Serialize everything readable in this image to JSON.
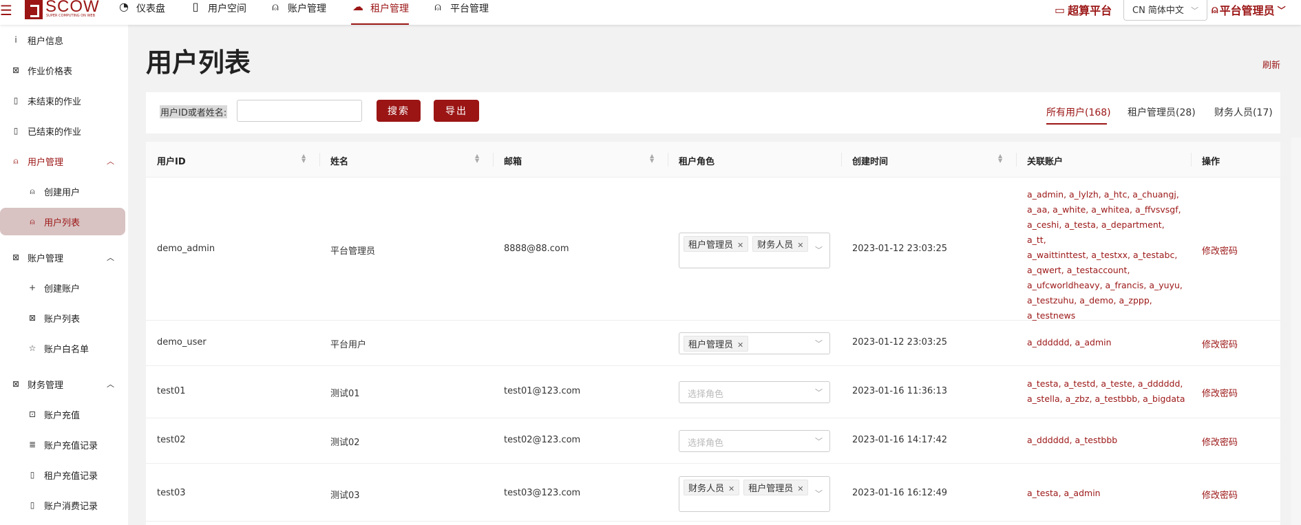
{
  "topbar": {
    "menu_icon": "hamburger-icon",
    "logo_name": "SCOW",
    "logo_sub": "SUPER COMPUTING ON WEB",
    "nav": [
      {
        "label": "仪表盘",
        "icon": "dashboard-icon"
      },
      {
        "label": "用户空间",
        "icon": "document-icon"
      },
      {
        "label": "账户管理",
        "icon": "user-icon"
      },
      {
        "label": "租户管理",
        "icon": "cloud-icon"
      },
      {
        "label": "平台管理",
        "icon": "user-icon"
      }
    ],
    "active_nav": "租户管理",
    "brand": "超算平台",
    "lang": "CN 简体中文",
    "user": "平台管理员"
  },
  "sidebar": {
    "items": [
      {
        "label": "租户信息",
        "icon": "info-icon"
      },
      {
        "label": "作业价格表",
        "icon": "price-icon"
      },
      {
        "label": "未结束的作业",
        "icon": "document-icon"
      },
      {
        "label": "已结束的作业",
        "icon": "document-icon"
      },
      {
        "label": "用户管理",
        "icon": "user-icon"
      },
      {
        "label": "创建用户",
        "icon": "user-icon"
      },
      {
        "label": "用户列表",
        "icon": "user-icon"
      },
      {
        "label": "账户管理",
        "icon": "account-icon"
      },
      {
        "label": "创建账户",
        "icon": "plus-icon"
      },
      {
        "label": "账户列表",
        "icon": "account-icon"
      },
      {
        "label": "账户白名单",
        "icon": "star-icon"
      },
      {
        "label": "财务管理",
        "icon": "money-icon"
      },
      {
        "label": "账户充值",
        "icon": "money-icon"
      },
      {
        "label": "账户充值记录",
        "icon": "list-icon"
      },
      {
        "label": "租户充值记录",
        "icon": "document-icon"
      },
      {
        "label": "账户消费记录",
        "icon": "document-icon"
      }
    ]
  },
  "page": {
    "title": "用户列表",
    "refresh": "刷新"
  },
  "filter": {
    "label": "用户ID或者姓名:",
    "input_value": "",
    "search_button": "搜索",
    "export_button": "导出",
    "tabs": [
      "所有用户(168)",
      "租户管理员(28)",
      "财务人员(17)"
    ],
    "active_tab": "所有用户(168)"
  },
  "table": {
    "headers": [
      "用户ID",
      "姓名",
      "邮箱",
      "租户角色",
      "创建时间",
      "关联账户",
      "操作"
    ],
    "role_placeholder": "选择角色",
    "rows": [
      {
        "id": "demo_admin",
        "name": "平台管理员",
        "email": "8888@88.com",
        "roles": [
          "租户管理员",
          "财务人员"
        ],
        "created": "2023-01-12 23:03:25",
        "accounts": [
          "a_admin, a_lylzh, a_htc, a_chuangj,",
          "a_aa, a_white, a_whitea, a_ffvsvsgf,",
          "a_ceshi, a_testa, a_department, a_tt,",
          "a_waittinttest, a_testxx, a_testabc,",
          "a_qwert, a_testaccount,",
          "a_ufcworldheavy, a_francis, a_yuyu,",
          "a_testzuhu, a_demo, a_zppp,",
          "a_testnews"
        ],
        "action": "修改密码"
      },
      {
        "id": "demo_user",
        "name": "平台用户",
        "email": "",
        "roles": [
          "租户管理员"
        ],
        "created": "2023-01-12 23:03:25",
        "accounts": [
          "a_dddddd, a_admin"
        ],
        "action": "修改密码"
      },
      {
        "id": "test01",
        "name": "测试01",
        "email": "test01@123.com",
        "roles": [],
        "created": "2023-01-16 11:36:13",
        "accounts": [
          "a_testa, a_testd, a_teste, a_dddddd,",
          "a_stella, a_zbz, a_testbbb, a_bigdata"
        ],
        "action": "修改密码"
      },
      {
        "id": "test02",
        "name": "测试02",
        "email": "test02@123.com",
        "roles": [],
        "created": "2023-01-16 14:17:42",
        "accounts": [
          "a_dddddd, a_testbbb"
        ],
        "action": "修改密码"
      },
      {
        "id": "test03",
        "name": "测试03",
        "email": "test03@123.com",
        "roles": [
          "财务人员",
          "租户管理员"
        ],
        "created": "2023-01-16 16:12:49",
        "accounts": [
          "a_testa, a_admin"
        ],
        "action": "修改密码"
      }
    ]
  },
  "colors": {
    "accent": "#9b1515",
    "selected_bg": "#d8c2c2"
  }
}
